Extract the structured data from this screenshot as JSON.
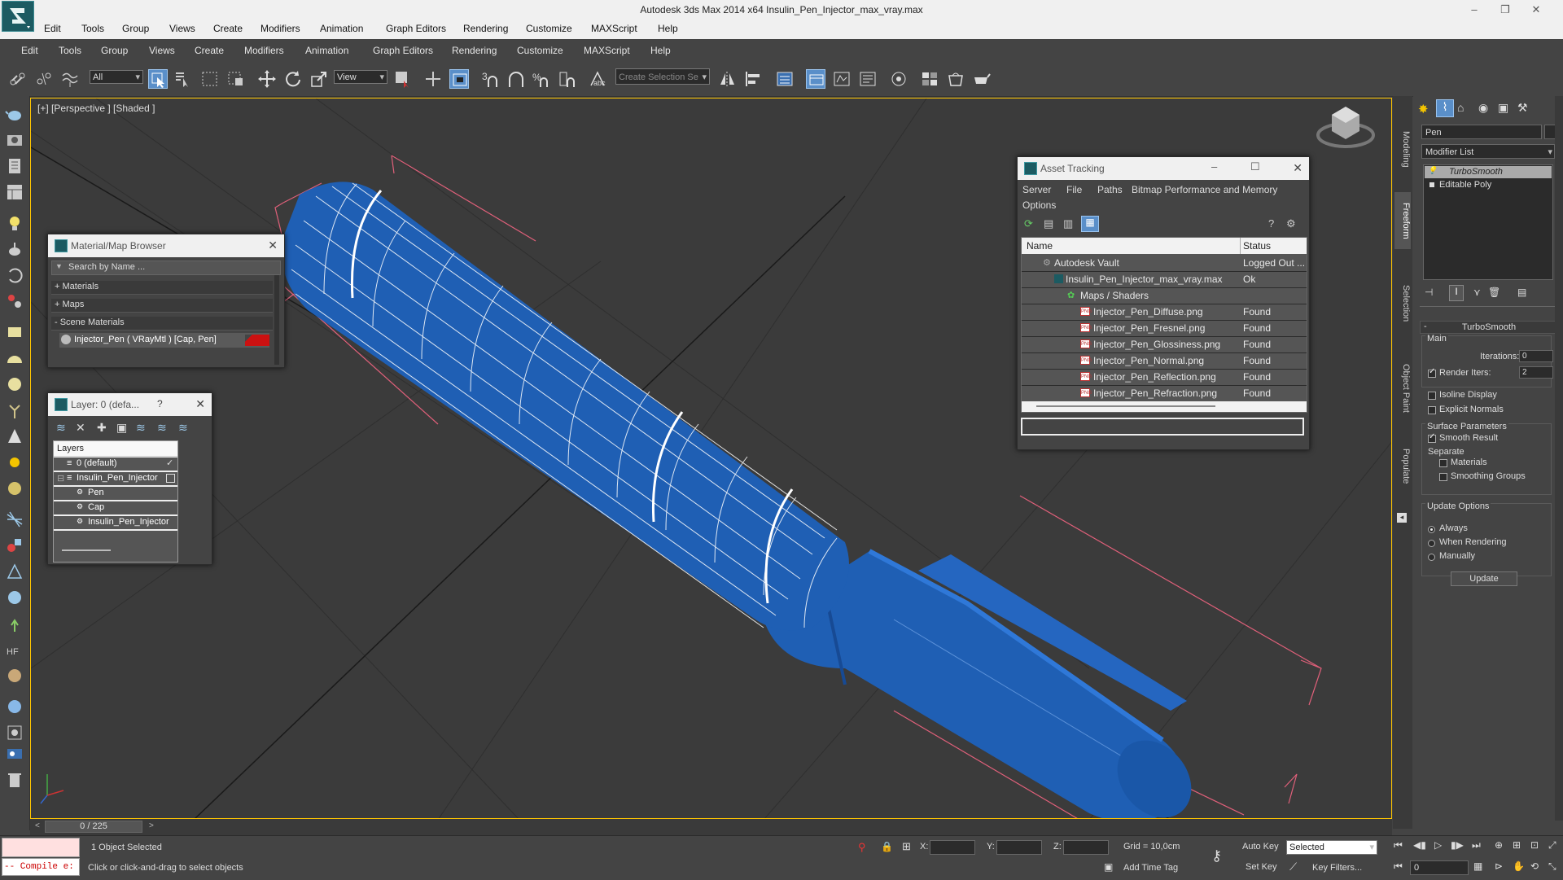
{
  "window": {
    "title": "Autodesk 3ds Max  2014 x64     Insulin_Pen_Injector_max_vray.max",
    "controls": [
      "–",
      "❐",
      "✕"
    ]
  },
  "menubar1": [
    "Edit",
    "Tools",
    "Group",
    "Views",
    "Create",
    "Modifiers",
    "Animation",
    "Graph Editors",
    "Rendering",
    "Customize",
    "MAXScript",
    "Help"
  ],
  "menubar2": [
    "Edit",
    "Tools",
    "Group",
    "Views",
    "Create",
    "Modifiers",
    "Animation",
    "Graph Editors",
    "Rendering",
    "Customize",
    "MAXScript",
    "Help"
  ],
  "toolbar": {
    "selection_filter": "All",
    "reference_coord": "View",
    "snap_3": "3",
    "named_selection_placeholder": "Create Selection Se"
  },
  "viewport": {
    "label": "[+] [Perspective ] [Shaded ]"
  },
  "material_browser": {
    "title": "Material/Map Browser",
    "search_placeholder": "Search by Name ...",
    "sections": [
      "+ Materials",
      "+ Maps",
      "- Scene Materials"
    ],
    "scene_material": "Injector_Pen  ( VRayMtl )  [Cap, Pen]"
  },
  "layer_window": {
    "title": "Layer: 0 (defa...",
    "help": "?",
    "header": "Layers",
    "items": [
      "0 (default)",
      "Insulin_Pen_Injector",
      "Pen",
      "Cap",
      "Insulin_Pen_Injector"
    ]
  },
  "asset_tracking": {
    "title": "Asset Tracking",
    "menu": [
      "Server",
      "File",
      "Paths",
      "Bitmap Performance and Memory",
      "Options"
    ],
    "columns": [
      "Name",
      "Status"
    ],
    "rows": [
      {
        "name": "Autodesk Vault",
        "status": "Logged Out ..."
      },
      {
        "name": "Insulin_Pen_Injector_max_vray.max",
        "status": "Ok"
      },
      {
        "name": "Maps / Shaders",
        "status": ""
      },
      {
        "name": "Injector_Pen_Diffuse.png",
        "status": "Found"
      },
      {
        "name": "Injector_Pen_Fresnel.png",
        "status": "Found"
      },
      {
        "name": "Injector_Pen_Glossiness.png",
        "status": "Found"
      },
      {
        "name": "Injector_Pen_Normal.png",
        "status": "Found"
      },
      {
        "name": "Injector_Pen_Reflection.png",
        "status": "Found"
      },
      {
        "name": "Injector_Pen_Refraction.png",
        "status": "Found"
      }
    ]
  },
  "ribbon_tabs": [
    "Modeling",
    "Freeform",
    "Selection",
    "Object Paint",
    "Populate"
  ],
  "command_panel": {
    "object_name": "Pen",
    "modifier_list": "Modifier List",
    "stack": [
      "TurboSmooth",
      "Editable Poly"
    ],
    "rollout_title": "TurboSmooth",
    "main_group": "Main",
    "iterations_label": "Iterations:",
    "iterations_value": "0",
    "render_iters_label": "Render Iters:",
    "render_iters_value": "2",
    "isoline_display": "Isoline Display",
    "explicit_normals": "Explicit Normals",
    "surface_params": "Surface Parameters",
    "smooth_result": "Smooth Result",
    "separate": "Separate",
    "materials": "Materials",
    "smoothing_groups": "Smoothing Groups",
    "update_options": "Update Options",
    "always": "Always",
    "when_rendering": "When Rendering",
    "manually": "Manually",
    "update_button": "Update"
  },
  "timeline": {
    "frame": "0 / 225"
  },
  "status": {
    "maxscript": "-- Compile e:",
    "selected": "1 Object Selected",
    "prompt": "Click or click-and-drag to select objects",
    "x_label": "X:",
    "y_label": "Y:",
    "z_label": "Z:",
    "grid": "Grid = 10,0cm",
    "add_time_tag": "Add Time Tag",
    "auto_key": "Auto Key",
    "set_key": "Set Key",
    "key_mode": "Selected",
    "key_filters": "Key Filters...",
    "frame_value": "0"
  },
  "colors": {
    "pen_blue": "#1f5fb4",
    "wire_white": "#ffffff",
    "viewport_border": "#ffc600",
    "bbox_pink": "#e0607a",
    "material_red": "#cc1111"
  }
}
